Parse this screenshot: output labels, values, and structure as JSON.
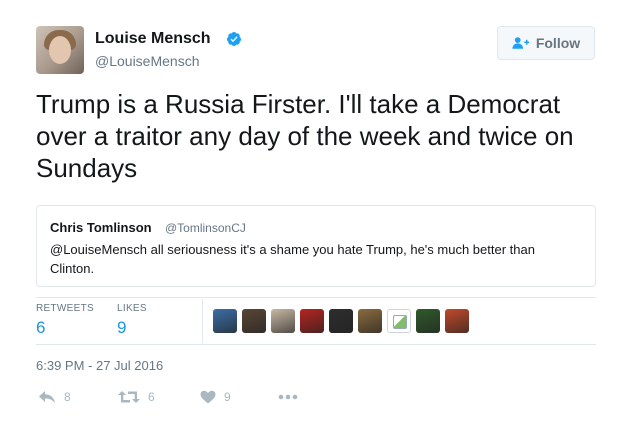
{
  "author": {
    "name": "Louise Mensch",
    "handle": "@LouiseMensch",
    "verified": true
  },
  "follow_button": {
    "label": "Follow",
    "icon": "add-user-icon"
  },
  "tweet": {
    "text": "Trump is a Russia Firster. I'll take a Democrat over a traitor any day of the week and twice on Sundays"
  },
  "quoted_tweet": {
    "name": "Chris Tomlinson",
    "handle": "@TomlinsonCJ",
    "text": "@LouiseMensch all seriousness it's a shame you hate Trump, he's much better than Clinton."
  },
  "stats": {
    "retweets_label": "RETWEETS",
    "retweets_value": "6",
    "likes_label": "LIKES",
    "likes_value": "9"
  },
  "likers": [
    {
      "color": "#3b6ea8"
    },
    {
      "color": "#5a4636"
    },
    {
      "color": "#c9b8a4"
    },
    {
      "color": "#b5241f"
    },
    {
      "color": "#2d2d2d"
    },
    {
      "color": "#8a6b3e"
    },
    {
      "color": "#ffffff",
      "broken": true
    },
    {
      "color": "#2f5a2a"
    },
    {
      "color": "#c24a2a"
    }
  ],
  "timestamp": "6:39 PM - 27 Jul 2016",
  "actions": {
    "reply_count": "8",
    "retweet_count": "6",
    "like_count": "9"
  },
  "colors": {
    "link_blue": "#1b95e0",
    "muted": "#657786",
    "border": "#e1e8ed",
    "verified_blue": "#1da1f2"
  }
}
